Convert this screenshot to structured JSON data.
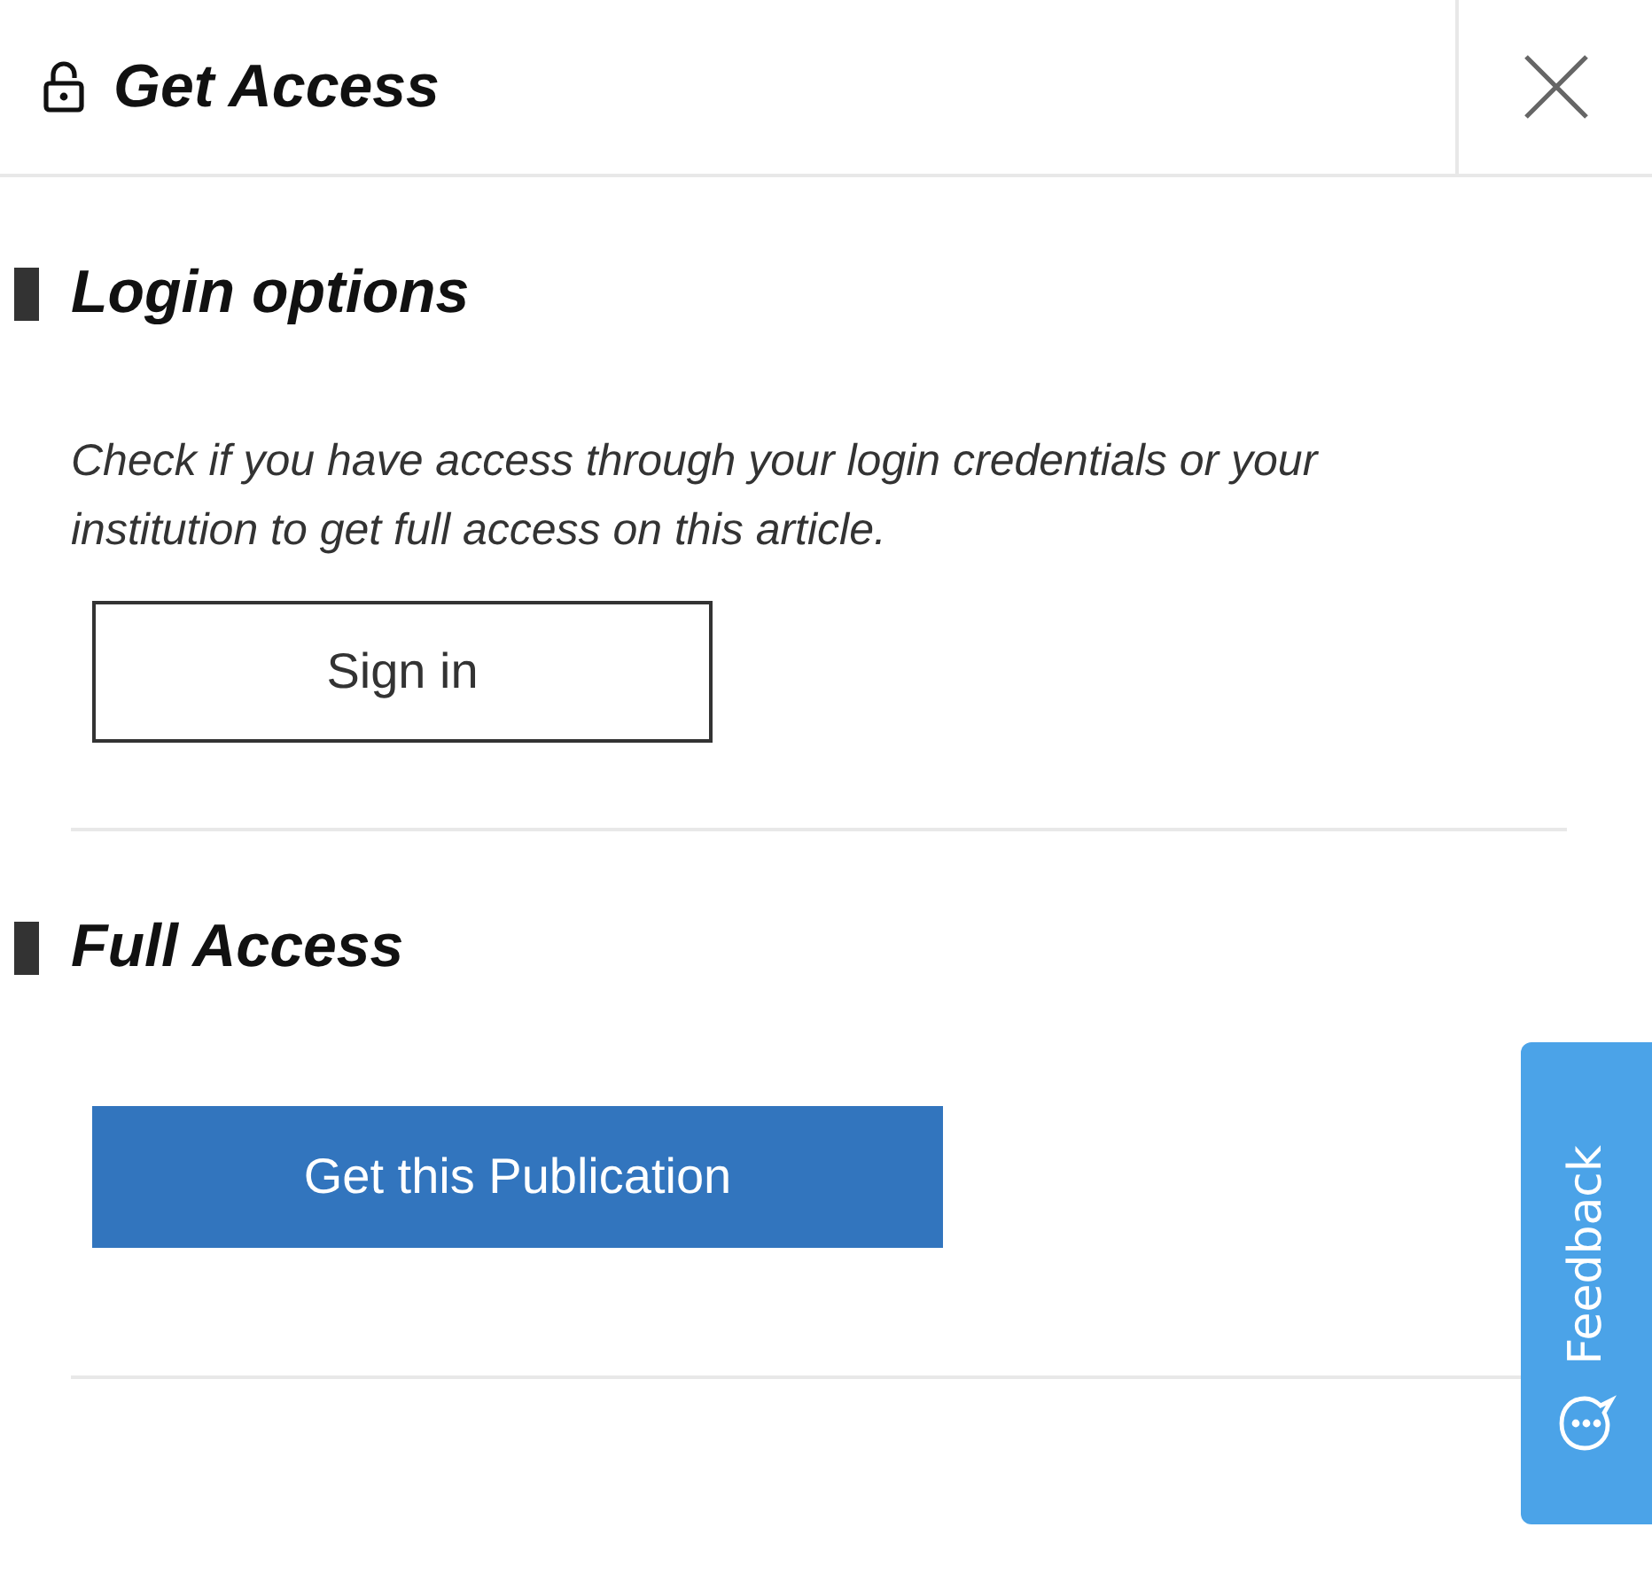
{
  "header": {
    "title": "Get Access"
  },
  "sections": [
    {
      "title": "Login options",
      "description": "Check if you have access through your login credentials or your institution to get full access on this article.",
      "button": {
        "label": "Sign in",
        "kind": "outline"
      }
    },
    {
      "title": "Full Access",
      "button": {
        "label": "Get this Publication",
        "kind": "primary"
      }
    }
  ],
  "feedback_tab": {
    "label": "Feedback"
  }
}
